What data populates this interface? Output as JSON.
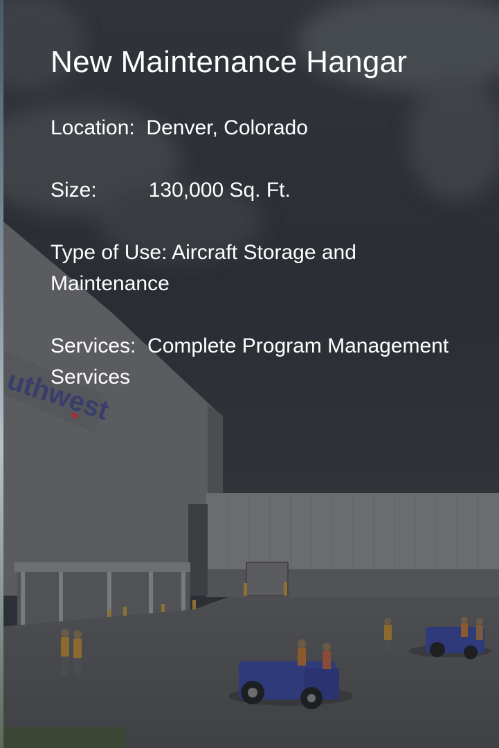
{
  "slide": {
    "title": "New Maintenance Hangar",
    "location": "Location:  Denver, Colorado",
    "size": "Size:         130,000 Sq. Ft.",
    "type_of_use": "Type of Use: Aircraft Storage and Maintenance",
    "services": "Services:  Complete Program Management Services"
  },
  "photo": {
    "signage_text": "uthwest",
    "subject": "hangar-photo"
  },
  "colors": {
    "overlay": "#2c3036",
    "text": "#ffffff",
    "sign_red": "#b02a30"
  }
}
